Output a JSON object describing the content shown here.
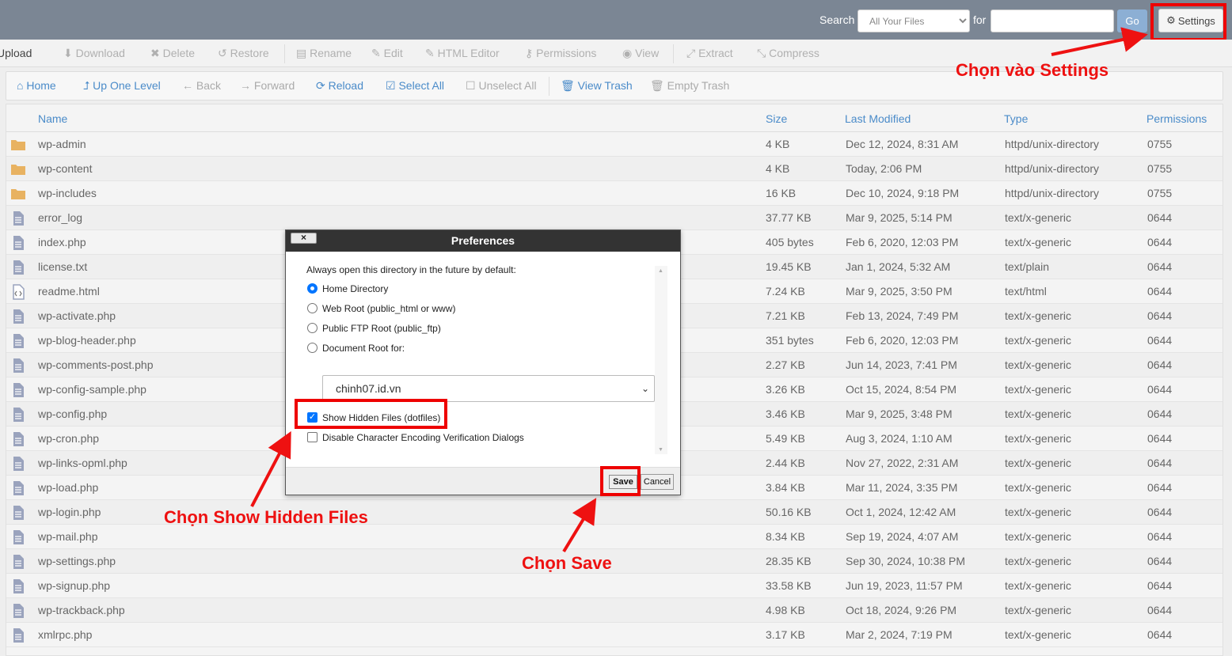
{
  "topbar": {
    "search_label": "Search",
    "search_scope": "All Your Files",
    "for_label": "for",
    "search_value": "",
    "go_label": "Go",
    "settings_label": "Settings",
    "settings_icon": "gear-icon"
  },
  "toolbar1": {
    "items": [
      {
        "label": "Upload",
        "icon": "upload-icon"
      },
      {
        "label": "Download",
        "icon": "download-icon"
      },
      {
        "label": "Delete",
        "icon": "close-icon"
      },
      {
        "label": "Restore",
        "icon": "restore-icon"
      },
      {
        "label": "Rename",
        "icon": "file-icon"
      },
      {
        "label": "Edit",
        "icon": "pencil-icon"
      },
      {
        "label": "HTML Editor",
        "icon": "edit-icon"
      },
      {
        "label": "Permissions",
        "icon": "key-icon"
      },
      {
        "label": "View",
        "icon": "eye-icon"
      },
      {
        "label": "Extract",
        "icon": "expand-icon"
      },
      {
        "label": "Compress",
        "icon": "compress-icon"
      }
    ]
  },
  "toolbar2": {
    "items": [
      {
        "label": "Home",
        "icon": "home-icon"
      },
      {
        "label": "Up One Level",
        "icon": "arrow-up-icon"
      },
      {
        "label": "Back",
        "icon": "arrow-left-icon"
      },
      {
        "label": "Forward",
        "icon": "arrow-right-icon"
      },
      {
        "label": "Reload",
        "icon": "reload-icon"
      },
      {
        "label": "Select All",
        "icon": "checkbox-checked-icon"
      },
      {
        "label": "Unselect All",
        "icon": "checkbox-empty-icon"
      },
      {
        "label": "View Trash",
        "icon": "trash-icon"
      },
      {
        "label": "Empty Trash",
        "icon": "trash-icon"
      }
    ]
  },
  "table": {
    "headers": {
      "name": "Name",
      "size": "Size",
      "modified": "Last Modified",
      "type": "Type",
      "perms": "Permissions"
    },
    "rows": [
      {
        "name": "wp-admin",
        "size": "4 KB",
        "modified": "Dec 12, 2024, 8:31 AM",
        "type": "httpd/unix-directory",
        "perms": "0755",
        "icon": "folder-icon"
      },
      {
        "name": "wp-content",
        "size": "4 KB",
        "modified": "Today, 2:06 PM",
        "type": "httpd/unix-directory",
        "perms": "0755",
        "icon": "folder-icon"
      },
      {
        "name": "wp-includes",
        "size": "16 KB",
        "modified": "Dec 10, 2024, 9:18 PM",
        "type": "httpd/unix-directory",
        "perms": "0755",
        "icon": "folder-icon"
      },
      {
        "name": "error_log",
        "size": "37.77 KB",
        "modified": "Mar 9, 2025, 5:14 PM",
        "type": "text/x-generic",
        "perms": "0644",
        "icon": "file-icon"
      },
      {
        "name": "index.php",
        "size": "405 bytes",
        "modified": "Feb 6, 2020, 12:03 PM",
        "type": "text/x-generic",
        "perms": "0644",
        "icon": "file-icon"
      },
      {
        "name": "license.txt",
        "size": "19.45 KB",
        "modified": "Jan 1, 2024, 5:32 AM",
        "type": "text/plain",
        "perms": "0644",
        "icon": "file-icon"
      },
      {
        "name": "readme.html",
        "size": "7.24 KB",
        "modified": "Mar 9, 2025, 3:50 PM",
        "type": "text/html",
        "perms": "0644",
        "icon": "code-file-icon"
      },
      {
        "name": "wp-activate.php",
        "size": "7.21 KB",
        "modified": "Feb 13, 2024, 7:49 PM",
        "type": "text/x-generic",
        "perms": "0644",
        "icon": "file-icon"
      },
      {
        "name": "wp-blog-header.php",
        "size": "351 bytes",
        "modified": "Feb 6, 2020, 12:03 PM",
        "type": "text/x-generic",
        "perms": "0644",
        "icon": "file-icon"
      },
      {
        "name": "wp-comments-post.php",
        "size": "2.27 KB",
        "modified": "Jun 14, 2023, 7:41 PM",
        "type": "text/x-generic",
        "perms": "0644",
        "icon": "file-icon"
      },
      {
        "name": "wp-config-sample.php",
        "size": "3.26 KB",
        "modified": "Oct 15, 2024, 8:54 PM",
        "type": "text/x-generic",
        "perms": "0644",
        "icon": "file-icon"
      },
      {
        "name": "wp-config.php",
        "size": "3.46 KB",
        "modified": "Mar 9, 2025, 3:48 PM",
        "type": "text/x-generic",
        "perms": "0644",
        "icon": "file-icon"
      },
      {
        "name": "wp-cron.php",
        "size": "5.49 KB",
        "modified": "Aug 3, 2024, 1:10 AM",
        "type": "text/x-generic",
        "perms": "0644",
        "icon": "file-icon"
      },
      {
        "name": "wp-links-opml.php",
        "size": "2.44 KB",
        "modified": "Nov 27, 2022, 2:31 AM",
        "type": "text/x-generic",
        "perms": "0644",
        "icon": "file-icon"
      },
      {
        "name": "wp-load.php",
        "size": "3.84 KB",
        "modified": "Mar 11, 2024, 3:35 PM",
        "type": "text/x-generic",
        "perms": "0644",
        "icon": "file-icon"
      },
      {
        "name": "wp-login.php",
        "size": "50.16 KB",
        "modified": "Oct 1, 2024, 12:42 AM",
        "type": "text/x-generic",
        "perms": "0644",
        "icon": "file-icon"
      },
      {
        "name": "wp-mail.php",
        "size": "8.34 KB",
        "modified": "Sep 19, 2024, 4:07 AM",
        "type": "text/x-generic",
        "perms": "0644",
        "icon": "file-icon"
      },
      {
        "name": "wp-settings.php",
        "size": "28.35 KB",
        "modified": "Sep 30, 2024, 10:38 PM",
        "type": "text/x-generic",
        "perms": "0644",
        "icon": "file-icon"
      },
      {
        "name": "wp-signup.php",
        "size": "33.58 KB",
        "modified": "Jun 19, 2023, 11:57 PM",
        "type": "text/x-generic",
        "perms": "0644",
        "icon": "file-icon"
      },
      {
        "name": "wp-trackback.php",
        "size": "4.98 KB",
        "modified": "Oct 18, 2024, 9:26 PM",
        "type": "text/x-generic",
        "perms": "0644",
        "icon": "file-icon"
      },
      {
        "name": "xmlrpc.php",
        "size": "3.17 KB",
        "modified": "Mar 2, 2024, 7:19 PM",
        "type": "text/x-generic",
        "perms": "0644",
        "icon": "file-icon"
      }
    ]
  },
  "dialog": {
    "title": "Preferences",
    "close_label": "×",
    "intro": "Always open this directory in the future by default:",
    "options": [
      {
        "label": "Home Directory",
        "selected": true
      },
      {
        "label": "Web Root (public_html or www)",
        "selected": false
      },
      {
        "label": "Public FTP Root (public_ftp)",
        "selected": false
      },
      {
        "label": "Document Root for:",
        "selected": false
      }
    ],
    "docroot_value": "chinh07.id.vn",
    "show_hidden_label": "Show Hidden Files (dotfiles)",
    "show_hidden_checked": true,
    "disable_encoding_label": "Disable Character Encoding Verification Dialogs",
    "disable_encoding_checked": false,
    "save_label": "Save",
    "cancel_label": "Cancel"
  },
  "annotations": {
    "settings": "Chọn vào Settings",
    "hidden": "Chọn Show Hidden Files",
    "save": "Chọn Save"
  },
  "colors": {
    "topbar": "#7b8694",
    "link": "#4a8bc9",
    "highlight": "#ee0000",
    "folder": "#e8b261",
    "file": "#9aa3bd"
  }
}
